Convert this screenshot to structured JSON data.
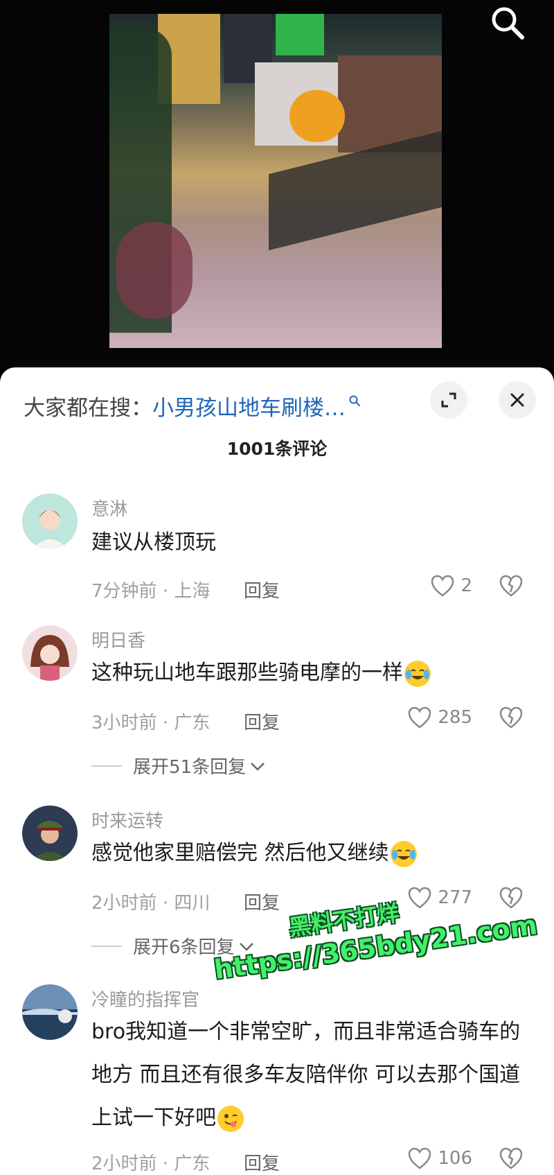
{
  "search_bar": {
    "prefix": "大家都在搜：",
    "query": "小男孩山地车刷楼…"
  },
  "comment_count": "1001条评论",
  "comments": [
    {
      "user": "意淋",
      "text": "建议从楼顶玩",
      "time_loc": "7分钟前 · 上海",
      "reply_label": "回复",
      "likes": "2"
    },
    {
      "user": "明日香",
      "text": "这种玩山地车跟那些骑电摩的一样",
      "emoji": "cry-laugh-emoji",
      "time_loc": "3小时前 · 广东",
      "reply_label": "回复",
      "likes": "285",
      "expand": "展开51条回复"
    },
    {
      "user": "时来运转",
      "text": "感觉他家里赔偿完 然后他又继续",
      "emoji": "cry-laugh-emoji",
      "time_loc": "2小时前 · 四川",
      "reply_label": "回复",
      "likes": "277",
      "expand": "展开6条回复"
    },
    {
      "user": "冷瞳的指挥官",
      "text": "bro我知道一个非常空旷，而且非常适合骑车的地方 而且还有很多车友陪伴你 可以去那个国道上试一下好吧",
      "emoji": "yum-emoji",
      "time_loc": "2小时前 · 广东",
      "reply_label": "回复",
      "likes": "106"
    }
  ],
  "watermark": {
    "line1": "黑料不打烊",
    "line2": "https://365bdy21.com"
  },
  "colors": {
    "link": "#1f66b8",
    "watermark": "#43f06a"
  }
}
